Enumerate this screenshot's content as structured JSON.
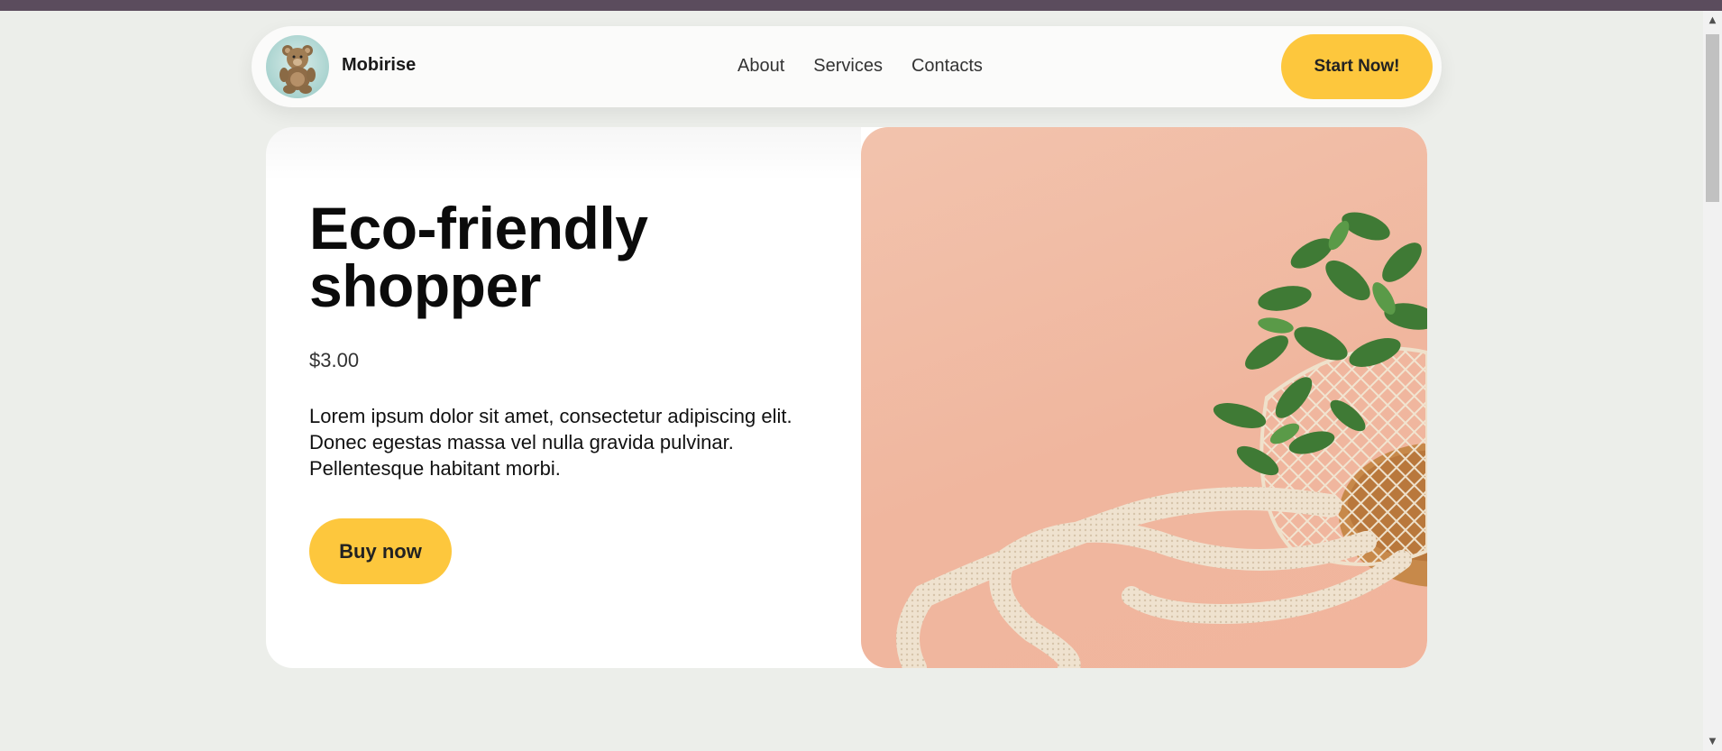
{
  "brand": {
    "name": "Mobirise",
    "logo_icon": "teddy-bear-icon"
  },
  "nav": {
    "links": [
      "About",
      "Services",
      "Contacts"
    ],
    "cta_label": "Start Now!"
  },
  "hero": {
    "title": "Eco-friendly shopper",
    "price": "$3.00",
    "description": "Lorem ipsum dolor sit amet, consectetur adipiscing elit. Donec egestas massa vel nulla gravida pulvinar. Pellentesque habitant morbi.",
    "button_label": "Buy now",
    "image_icon": "mesh-bag-with-mint-image"
  },
  "colors": {
    "accent": "#fdc73d",
    "background": "#eceeea",
    "image_background": "#f0b69e"
  },
  "scrollbar": {
    "up_icon": "arrow-up-icon",
    "down_icon": "arrow-down-icon"
  }
}
